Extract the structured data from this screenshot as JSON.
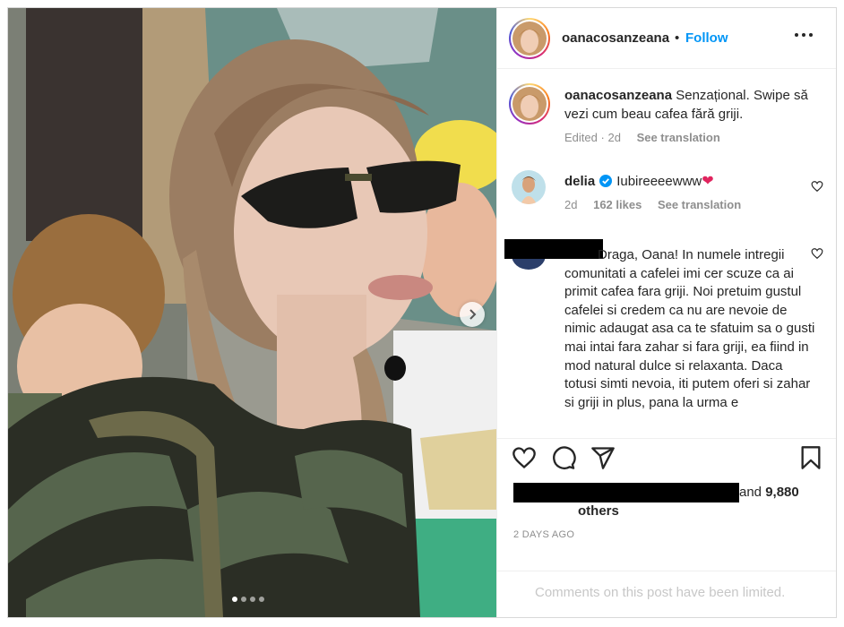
{
  "post": {
    "author": {
      "username": "oanacosanzeana",
      "follow_label": "Follow",
      "separator": "•"
    },
    "caption": {
      "username": "oanacosanzeana",
      "text": "Senzațional. Swipe să vezi cum beau cafea fără griji.",
      "edited_label": "Edited",
      "age": "2d",
      "see_translation": "See translation"
    },
    "comments": [
      {
        "username": "delia",
        "verified": true,
        "text": "Iubireeeewww",
        "emoji": "❤",
        "age": "2d",
        "likes": "162 likes",
        "see_translation": "See translation"
      },
      {
        "username_redacted": true,
        "text": "Draga, Oana! In numele intregii comunitati a cafelei imi cer scuze ca ai primit cafea fara griji. Noi pretuim gustul cafelei si credem ca nu are nevoie de nimic adaugat asa ca te sfatuim sa o gusti mai intai fara zahar si fara griji, ea fiind in mod natural dulce si relaxanta. Daca totusi simti nevoia, iti putem oferi si zahar si griji in plus, pana la urma e"
      }
    ],
    "likes": {
      "suffix": "and",
      "count": "9,880",
      "others": "others"
    },
    "timestamp": "2 DAYS AGO",
    "comments_limited": "Comments on this post have been limited.",
    "carousel": {
      "total": 4,
      "active_index": 0
    }
  },
  "icons": {
    "more": "more-options-icon",
    "next": "chevron-right-icon",
    "like": "heart-icon",
    "comment": "comment-icon",
    "share": "send-icon",
    "save": "bookmark-icon",
    "verified": "verified-badge-icon"
  },
  "colors": {
    "follow": "#0095f6",
    "verified": "#0095f6",
    "heart_emoji": "#e0245e",
    "muted": "#8e8e8e"
  }
}
